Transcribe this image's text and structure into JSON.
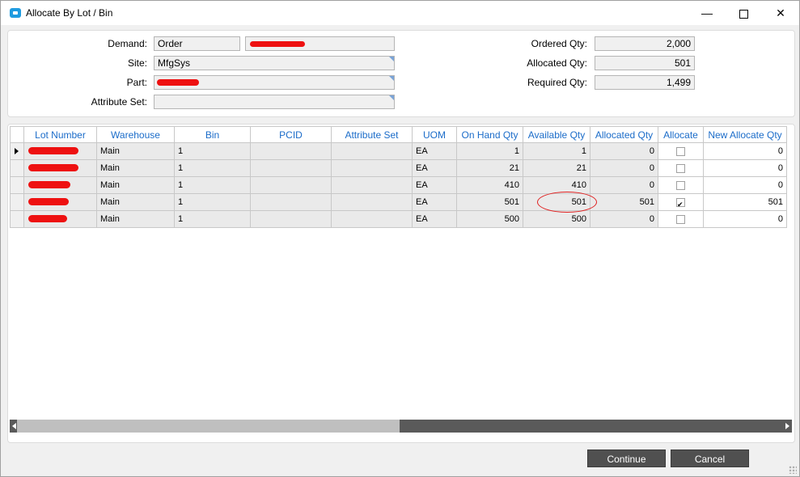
{
  "window": {
    "title": "Allocate By Lot / Bin",
    "accent_color": "#1e9be0"
  },
  "form": {
    "demand_label": "Demand:",
    "demand_type": "Order",
    "site_label": "Site:",
    "site_value": "MfgSys",
    "part_label": "Part:",
    "attribute_set_label": "Attribute Set:",
    "ordered_qty_label": "Ordered Qty:",
    "ordered_qty": "2,000",
    "allocated_qty_label": "Allocated Qty:",
    "allocated_qty": "501",
    "required_qty_label": "Required Qty:",
    "required_qty": "1,499"
  },
  "grid": {
    "header_color": "#1b6cc9",
    "columns": [
      "Lot Number",
      "Warehouse",
      "Bin",
      "PCID",
      "Attribute Set",
      "UOM",
      "On Hand Qty",
      "Available Qty",
      "Allocated Qty",
      "Allocate",
      "New Allocate Qty"
    ],
    "rows": [
      {
        "warehouse": "Main",
        "bin": "1",
        "pcid": "",
        "attr": "",
        "uom": "EA",
        "onhand": "1",
        "available": "1",
        "allocated": "0",
        "allocate": false,
        "newalloc": "0"
      },
      {
        "warehouse": "Main",
        "bin": "1",
        "pcid": "",
        "attr": "",
        "uom": "EA",
        "onhand": "21",
        "available": "21",
        "allocated": "0",
        "allocate": false,
        "newalloc": "0"
      },
      {
        "warehouse": "Main",
        "bin": "1",
        "pcid": "",
        "attr": "",
        "uom": "EA",
        "onhand": "410",
        "available": "410",
        "allocated": "0",
        "allocate": false,
        "newalloc": "0"
      },
      {
        "warehouse": "Main",
        "bin": "1",
        "pcid": "",
        "attr": "",
        "uom": "EA",
        "onhand": "501",
        "available": "501",
        "allocated": "501",
        "allocate": true,
        "newalloc": "501"
      },
      {
        "warehouse": "Main",
        "bin": "1",
        "pcid": "",
        "attr": "",
        "uom": "EA",
        "onhand": "500",
        "available": "500",
        "allocated": "0",
        "allocate": false,
        "newalloc": "0"
      }
    ]
  },
  "buttons": {
    "continue": "Continue",
    "cancel": "Cancel"
  }
}
